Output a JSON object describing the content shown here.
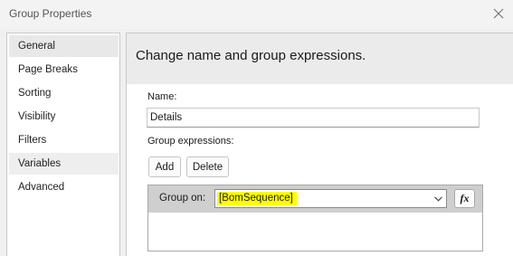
{
  "window": {
    "title": "Group Properties",
    "close_icon": "close-icon"
  },
  "sidebar": {
    "items": [
      {
        "label": "General",
        "state": "selected"
      },
      {
        "label": "Page Breaks",
        "state": "normal"
      },
      {
        "label": "Sorting",
        "state": "normal"
      },
      {
        "label": "Visibility",
        "state": "normal"
      },
      {
        "label": "Filters",
        "state": "normal"
      },
      {
        "label": "Variables",
        "state": "hover"
      },
      {
        "label": "Advanced",
        "state": "normal"
      }
    ]
  },
  "main": {
    "heading": "Change name and group expressions.",
    "name_label": "Name:",
    "name_value": "Details",
    "group_expressions_label": "Group expressions:",
    "add_label": "Add",
    "delete_label": "Delete",
    "group_on_label": "Group on:",
    "group_on_value": "[BomSequence]",
    "fx_label": "fx"
  },
  "colors": {
    "highlight": "#ffff00",
    "header_band": "#ebebeb",
    "selected_item": "#e8e8e8",
    "group_row": "#cfcfcf"
  }
}
